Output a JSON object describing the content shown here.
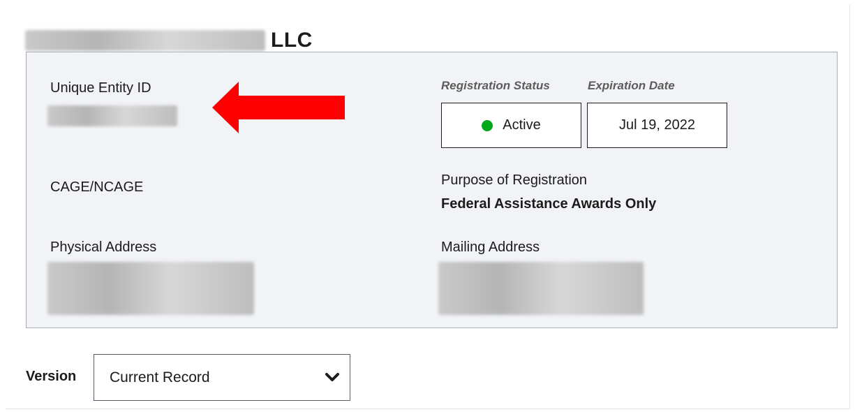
{
  "entity": {
    "name_suffix": "LLC"
  },
  "fields": {
    "unique_entity_id_label": "Unique Entity ID",
    "cage_label": "CAGE/NCAGE",
    "physical_address_label": "Physical Address",
    "registration_status_label": "Registration Status",
    "expiration_date_label": "Expiration Date",
    "status_value": "Active",
    "expiration_value": "Jul 19, 2022",
    "purpose_label": "Purpose of Registration",
    "purpose_value": "Federal Assistance Awards Only",
    "mailing_address_label": "Mailing Address"
  },
  "version": {
    "label": "Version",
    "selected": "Current Record"
  },
  "colors": {
    "status_active": "#00a91c",
    "annotation_arrow": "#ff0000",
    "panel_bg": "#f1f3f6"
  },
  "icons": {
    "status": "status-dot-icon",
    "dropdown": "chevron-down-icon",
    "annotation": "red-arrow-icon"
  }
}
